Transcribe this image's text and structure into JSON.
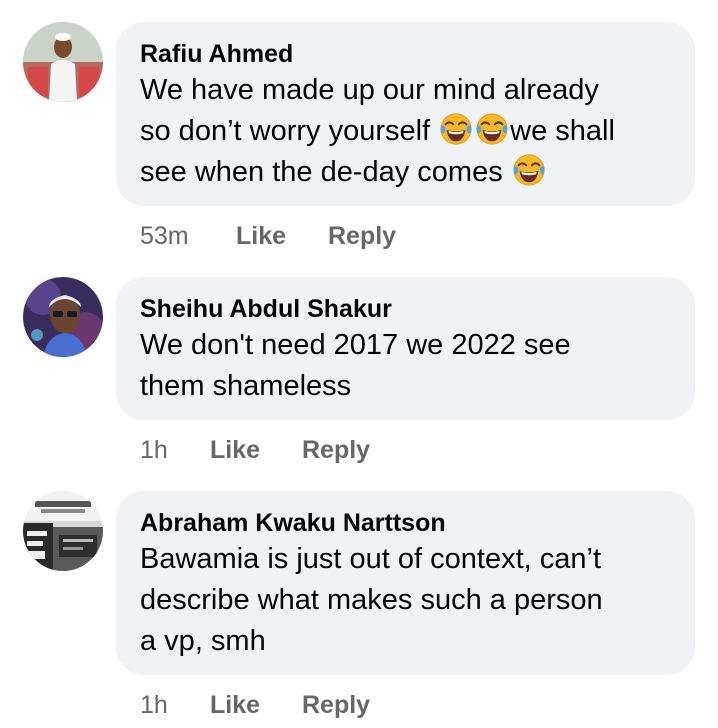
{
  "comments": [
    {
      "author": "Rafiu Ahmed",
      "text_line1": "We have made up our mind already",
      "text_line2a": "so don’t worry yourself ",
      "text_line2b": "we shall",
      "text_line3": "see when the de-day comes ",
      "emoji": "face-with-tears-of-joy-icon",
      "time": "53m",
      "like": "Like",
      "reply": "Reply"
    },
    {
      "author": "Sheihu Abdul Shakur",
      "text_line1": "We don't need 2017 we 2022 see",
      "text_line2": "them shameless",
      "time": "1h",
      "like": "Like",
      "reply": "Reply"
    },
    {
      "author": "Abraham Kwaku Narttson",
      "text_line1": "Bawamia is just out of context, can’t",
      "text_line2": "describe what makes such a person",
      "text_line3": "a vp, smh",
      "time": "1h",
      "like": "Like",
      "reply": "Reply"
    }
  ]
}
